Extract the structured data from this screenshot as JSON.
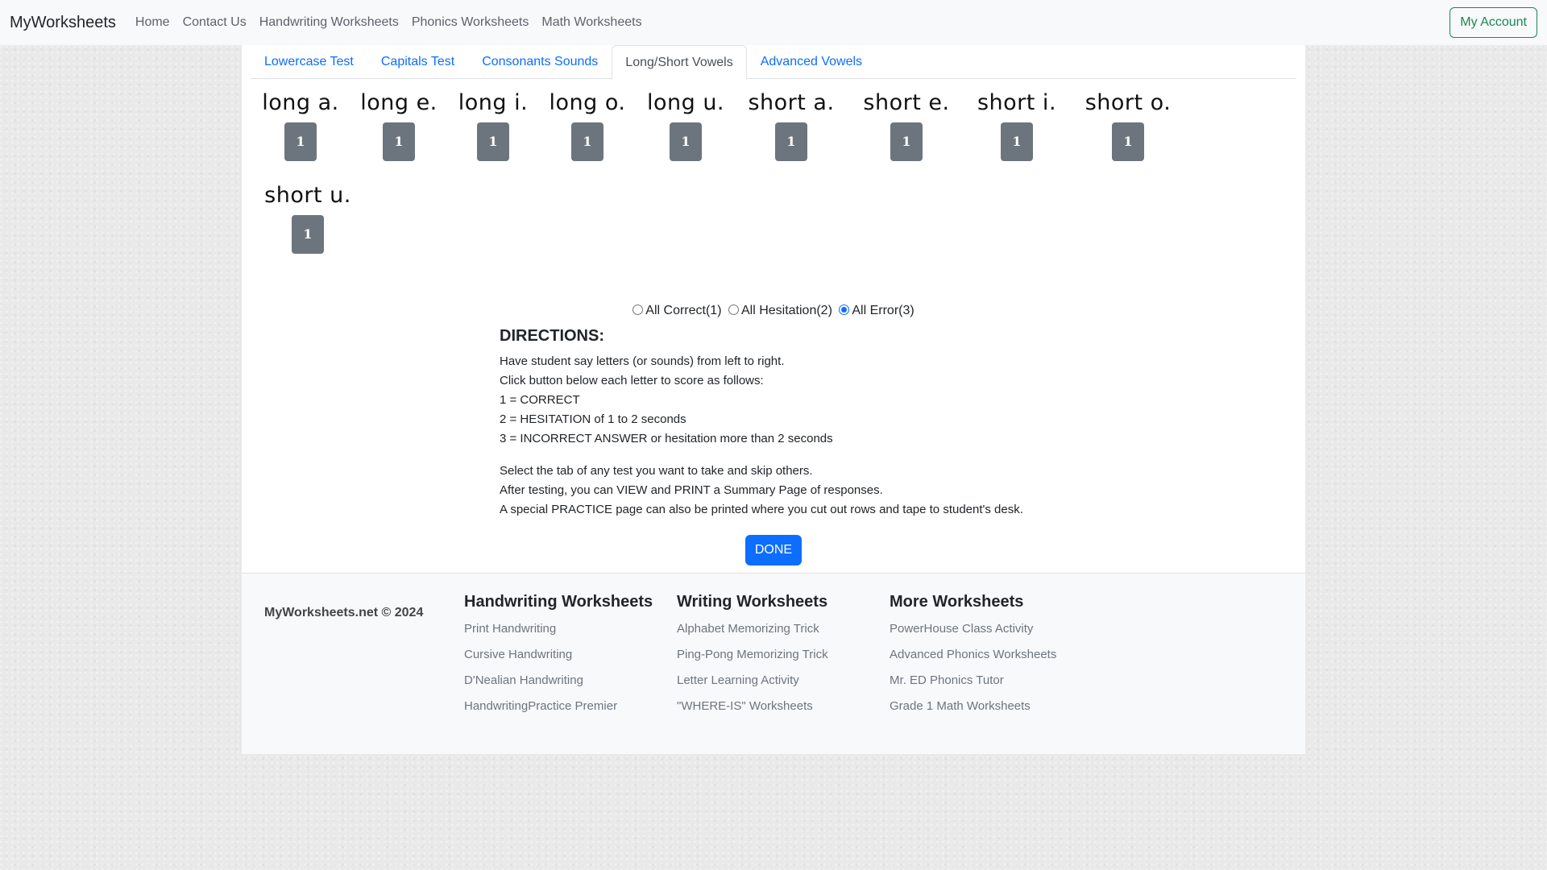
{
  "navbar": {
    "brand": "MyWorksheets",
    "links": [
      "Home",
      "Contact Us",
      "Handwriting Worksheets",
      "Phonics Worksheets",
      "Math Worksheets"
    ],
    "account": "My Account"
  },
  "tabs": [
    "Lowercase Test",
    "Capitals Test",
    "Consonants Sounds",
    "Long/Short Vowels",
    "Advanced Vowels"
  ],
  "active_tab": "Long/Short Vowels",
  "vowels": [
    {
      "label": "long a.",
      "score": "1"
    },
    {
      "label": "long e.",
      "score": "1"
    },
    {
      "label": "long i.",
      "score": "1"
    },
    {
      "label": "long o.",
      "score": "1"
    },
    {
      "label": "long u.",
      "score": "1"
    },
    {
      "label": "short a.",
      "score": "1"
    },
    {
      "label": "short e.",
      "score": "1"
    },
    {
      "label": "short i.",
      "score": "1"
    },
    {
      "label": "short o.",
      "score": "1"
    },
    {
      "label": "short u.",
      "score": "1"
    }
  ],
  "bulk_options": [
    {
      "label": "All Correct(1)",
      "checked": false
    },
    {
      "label": "All Hesitation(2)",
      "checked": false
    },
    {
      "label": "All Error(3)",
      "checked": true
    }
  ],
  "directions": {
    "title": "DIRECTIONS:",
    "lines": [
      "Have student say letters (or sounds) from left to right.",
      "Click button below each letter to score as follows:",
      "1 = CORRECT",
      "2 = HESITATION of 1 to 2 seconds",
      "3 = INCORRECT ANSWER or hesitation more than 2 seconds"
    ],
    "notes": [
      "Select the tab of any test you want to take and skip others.",
      "After testing, you can VIEW and PRINT a Summary Page of responses.",
      "A special PRACTICE page can also be printed where you cut out rows and tape to student's desk."
    ]
  },
  "done_label": "DONE",
  "footer": {
    "copyright": "MyWorksheets.net © 2024",
    "columns": [
      {
        "title": "Handwriting Worksheets",
        "links": [
          "Print Handwriting",
          "Cursive Handwriting",
          "D'Nealian Handwriting",
          "HandwritingPractice Premier"
        ]
      },
      {
        "title": "Writing Worksheets",
        "links": [
          "Alphabet Memorizing Trick",
          "Ping-Pong Memorizing Trick",
          "Letter Learning Activity",
          "\"WHERE-IS\" Worksheets"
        ]
      },
      {
        "title": "More Worksheets",
        "links": [
          "PowerHouse Class Activity",
          "Advanced Phonics Worksheets",
          "Mr. ED Phonics Tutor",
          "Grade 1 Math Worksheets"
        ]
      }
    ]
  }
}
